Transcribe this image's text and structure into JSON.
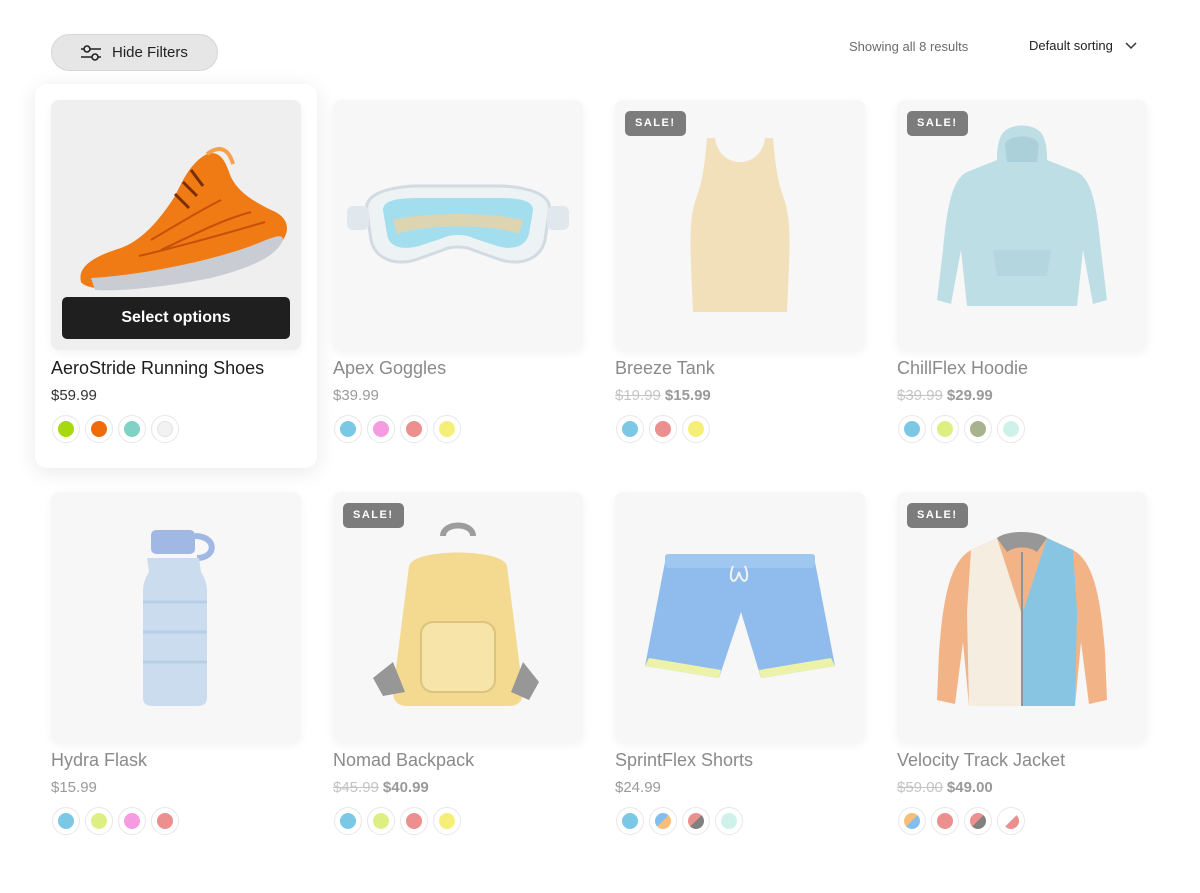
{
  "toolbar": {
    "filter_label": "Hide Filters",
    "results_text": "Showing all 8 results",
    "sort_label": "Default sorting"
  },
  "sale_badge": "SALE!",
  "select_options_label": "Select options",
  "products": [
    {
      "name": "AeroStride Running Shoes",
      "price": "$59.99",
      "old_price": "",
      "sale_price": "",
      "on_sale": false,
      "swatches": [
        "#a8d80e",
        "#f06a0a",
        "#7fd2c4",
        "#f2f2f2"
      ]
    },
    {
      "name": "Apex Goggles",
      "price": "$39.99",
      "old_price": "",
      "sale_price": "",
      "on_sale": false,
      "swatches": [
        "#4fb4dd",
        "#f07ad8",
        "#e46a6a",
        "#f2ea4a"
      ]
    },
    {
      "name": "Breeze Tank",
      "price": "",
      "old_price": "$19.99",
      "sale_price": "$15.99",
      "on_sale": true,
      "swatches": [
        "#4fb4dd",
        "#e46a6a",
        "#f2ea4a"
      ]
    },
    {
      "name": "ChillFlex Hoodie",
      "price": "",
      "old_price": "$39.99",
      "sale_price": "$29.99",
      "on_sale": true,
      "swatches": [
        "#4fb4dd",
        "#d2ea5a",
        "#8a9a6a",
        "#bdeee2"
      ]
    },
    {
      "name": "Hydra Flask",
      "price": "$15.99",
      "old_price": "",
      "sale_price": "",
      "on_sale": false,
      "swatches": [
        "#4fb4dd",
        "#d2ea5a",
        "#f07ad8",
        "#e46a6a"
      ]
    },
    {
      "name": "Nomad Backpack",
      "price": "",
      "old_price": "$45.99",
      "sale_price": "$40.99",
      "on_sale": true,
      "swatches": [
        "#4fb4dd",
        "#d2ea5a",
        "#e46a6a",
        "#f2ea4a"
      ]
    },
    {
      "name": "SprintFlex Shorts",
      "price": "$24.99",
      "old_price": "",
      "sale_price": "",
      "on_sale": false,
      "swatches": [
        "#4fb4dd",
        "split:#5aa8e8:#f5a84a",
        "split:#e46a6a:#555555",
        "#bdeee2"
      ]
    },
    {
      "name": "Velocity Track Jacket",
      "price": "",
      "old_price": "$59.00",
      "sale_price": "$49.00",
      "on_sale": true,
      "swatches": [
        "split:#f5a84a:#5aa8e8",
        "#e46a6a",
        "split:#e46a6a:#555555",
        "split:#ffffff:#e46a6a"
      ]
    }
  ]
}
